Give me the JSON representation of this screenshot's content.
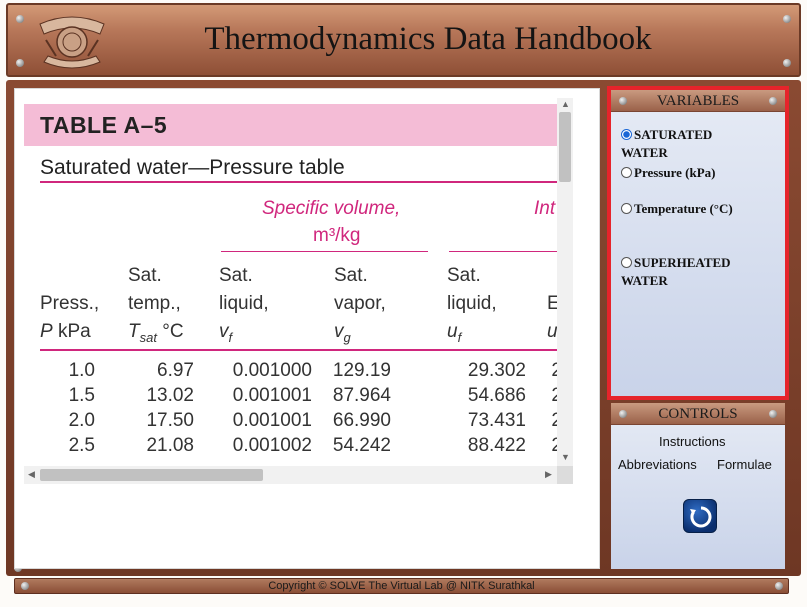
{
  "header": {
    "title": "Thermodynamics Data Handbook"
  },
  "table": {
    "title": "TABLE A–5",
    "subtitle": "Saturated water—Pressure table",
    "group_specific_volume": "Specific volume,",
    "group_specific_volume_unit": "m³/kg",
    "group_internal": "Int",
    "columns": [
      {
        "l1": "",
        "l2": "Press.,",
        "l3": "P kPa"
      },
      {
        "l1": "Sat.",
        "l2": "temp.,",
        "l3": "Tsat °C"
      },
      {
        "l1": "Sat.",
        "l2": "liquid,",
        "l3": "vf"
      },
      {
        "l1": "Sat.",
        "l2": "vapor,",
        "l3": "vg"
      },
      {
        "l1": "Sat.",
        "l2": "liquid,",
        "l3": "uf"
      },
      {
        "l1": "",
        "l2": "E",
        "l3": "u"
      }
    ],
    "rows": [
      [
        "1.0",
        "6.97",
        "0.001000",
        "129.19",
        "29.302",
        "2"
      ],
      [
        "1.5",
        "13.02",
        "0.001001",
        "87.964",
        "54.686",
        "2"
      ],
      [
        "2.0",
        "17.50",
        "0.001001",
        "66.990",
        "73.431",
        "2"
      ],
      [
        "2.5",
        "21.08",
        "0.001002",
        "54.242",
        "88.422",
        "2"
      ]
    ]
  },
  "variables": {
    "header": "VARIABLES",
    "options": [
      {
        "label": "SATURATED WATER",
        "checked": true
      },
      {
        "label": "Pressure (kPa)",
        "checked": false
      },
      {
        "label": "Temperature (°C)",
        "checked": false
      },
      {
        "label": "SUPERHEATED WATER",
        "checked": false
      }
    ]
  },
  "controls": {
    "header": "CONTROLS",
    "instructions": "Instructions",
    "abbreviations": "Abbreviations",
    "formulae": "Formulae",
    "reset_icon": "reset-icon"
  },
  "footer": {
    "copyright": "Copyright © SOLVE The Virtual Lab @ NITK Surathkal"
  },
  "colors": {
    "frame": "#8a4a32",
    "accent_pink": "#d0277d",
    "highlight_red": "#e6242b",
    "panel_blue": "#c9d3e9"
  }
}
